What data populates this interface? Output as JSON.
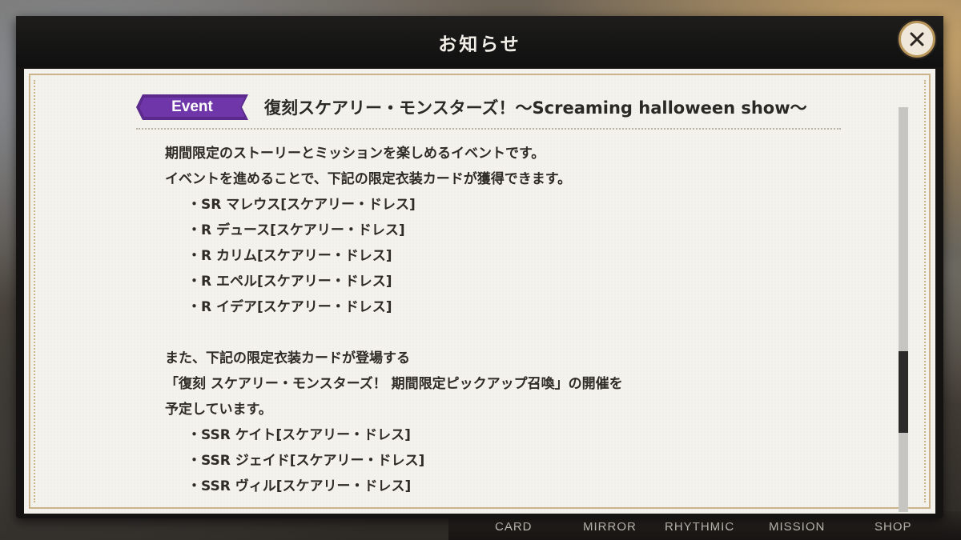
{
  "dialog": {
    "title": "お知らせ",
    "close_icon": "close-x-icon"
  },
  "notice": {
    "badge": "Event",
    "title": "復刻スケアリー・モンスターズ！〜Screaming halloween show〜",
    "lines": [
      "期間限定のストーリーとミッションを楽しめるイベントです。",
      "イベントを進めることで、下記の限定衣装カードが獲得できます。",
      "・SR マレウス[スケアリー・ドレス]",
      "・R デュース[スケアリー・ドレス]",
      "・R カリム[スケアリー・ドレス]",
      "・R エペル[スケアリー・ドレス]",
      "・R イデア[スケアリー・ドレス]",
      "",
      "また、下記の限定衣装カードが登場する",
      "「復刻 スケアリー・モンスターズ！ 期間限定ピックアップ召喚」の開催を",
      "予定しています。",
      "・SSR ケイト[スケアリー・ドレス]",
      "・SSR ジェイド[スケアリー・ドレス]",
      "・SSR ヴィル[スケアリー・ドレス]"
    ]
  },
  "bottom_nav": [
    "CARD",
    "MIRROR",
    "RHYTHMIC",
    "MISSION",
    "SHOP"
  ],
  "colors": {
    "badge": "#5b2a8c",
    "frame": "#c9b48c",
    "paper": "#f4f2ec"
  }
}
